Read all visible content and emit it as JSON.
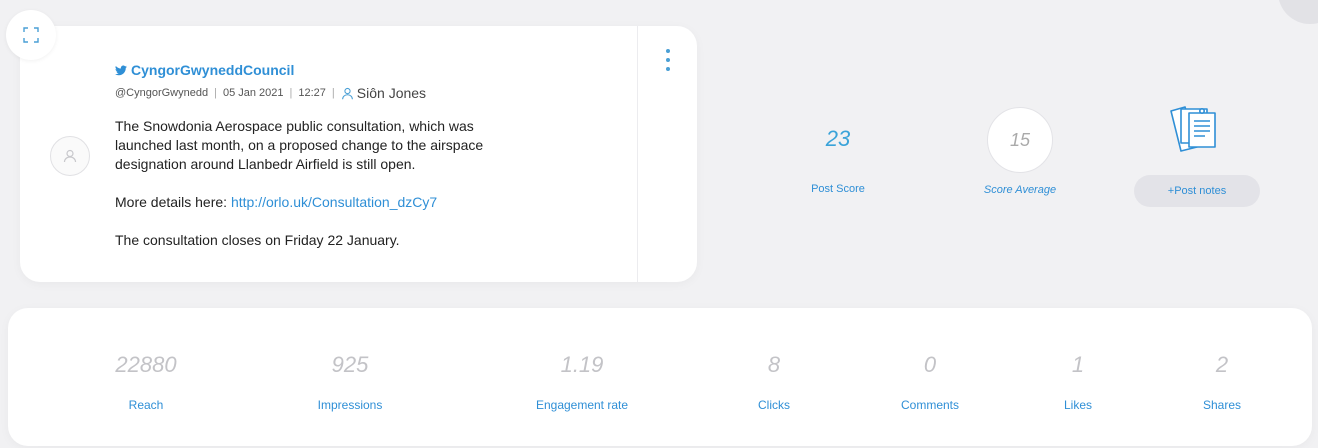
{
  "post": {
    "account_name": "CyngorGwyneddCouncil",
    "handle": "@CyngorGwynedd",
    "date": "05 Jan 2021",
    "time": "12:27",
    "author": "Siôn Jones",
    "body_lines": [
      "The Snowdonia Aerospace public consultation, which was",
      "launched last month, on a proposed change to the airspace",
      "designation around Llanbedr Airfield is still open."
    ],
    "more_prefix": "More details here: ",
    "link_text": "http://orlo.uk/Consultation_dzCy7",
    "closing_text": "The consultation closes on Friday 22 January."
  },
  "scores": {
    "post_score_value": "23",
    "post_score_label": "Post Score",
    "average_value": "15",
    "average_label": "Score Average",
    "notes_button_label": "+Post notes"
  },
  "stats": [
    {
      "value": "22880",
      "label": "Reach"
    },
    {
      "value": "925",
      "label": "Impressions"
    },
    {
      "value": "1.19",
      "label": "Engagement rate"
    },
    {
      "value": "8",
      "label": "Clicks"
    },
    {
      "value": "0",
      "label": "Comments"
    },
    {
      "value": "1",
      "label": "Likes"
    },
    {
      "value": "2",
      "label": "Shares"
    }
  ],
  "icons": {
    "expand": "expand-icon",
    "twitter": "twitter-icon",
    "user": "user-icon",
    "avatar": "avatar-placeholder-icon",
    "menu": "kebab-menu-icon",
    "notes": "notes-icon"
  },
  "colors": {
    "accent": "#2f8fd6",
    "score_value": "#3aa3d9",
    "stat_value": "#c3c3c7",
    "background": "#f1f1f3"
  }
}
